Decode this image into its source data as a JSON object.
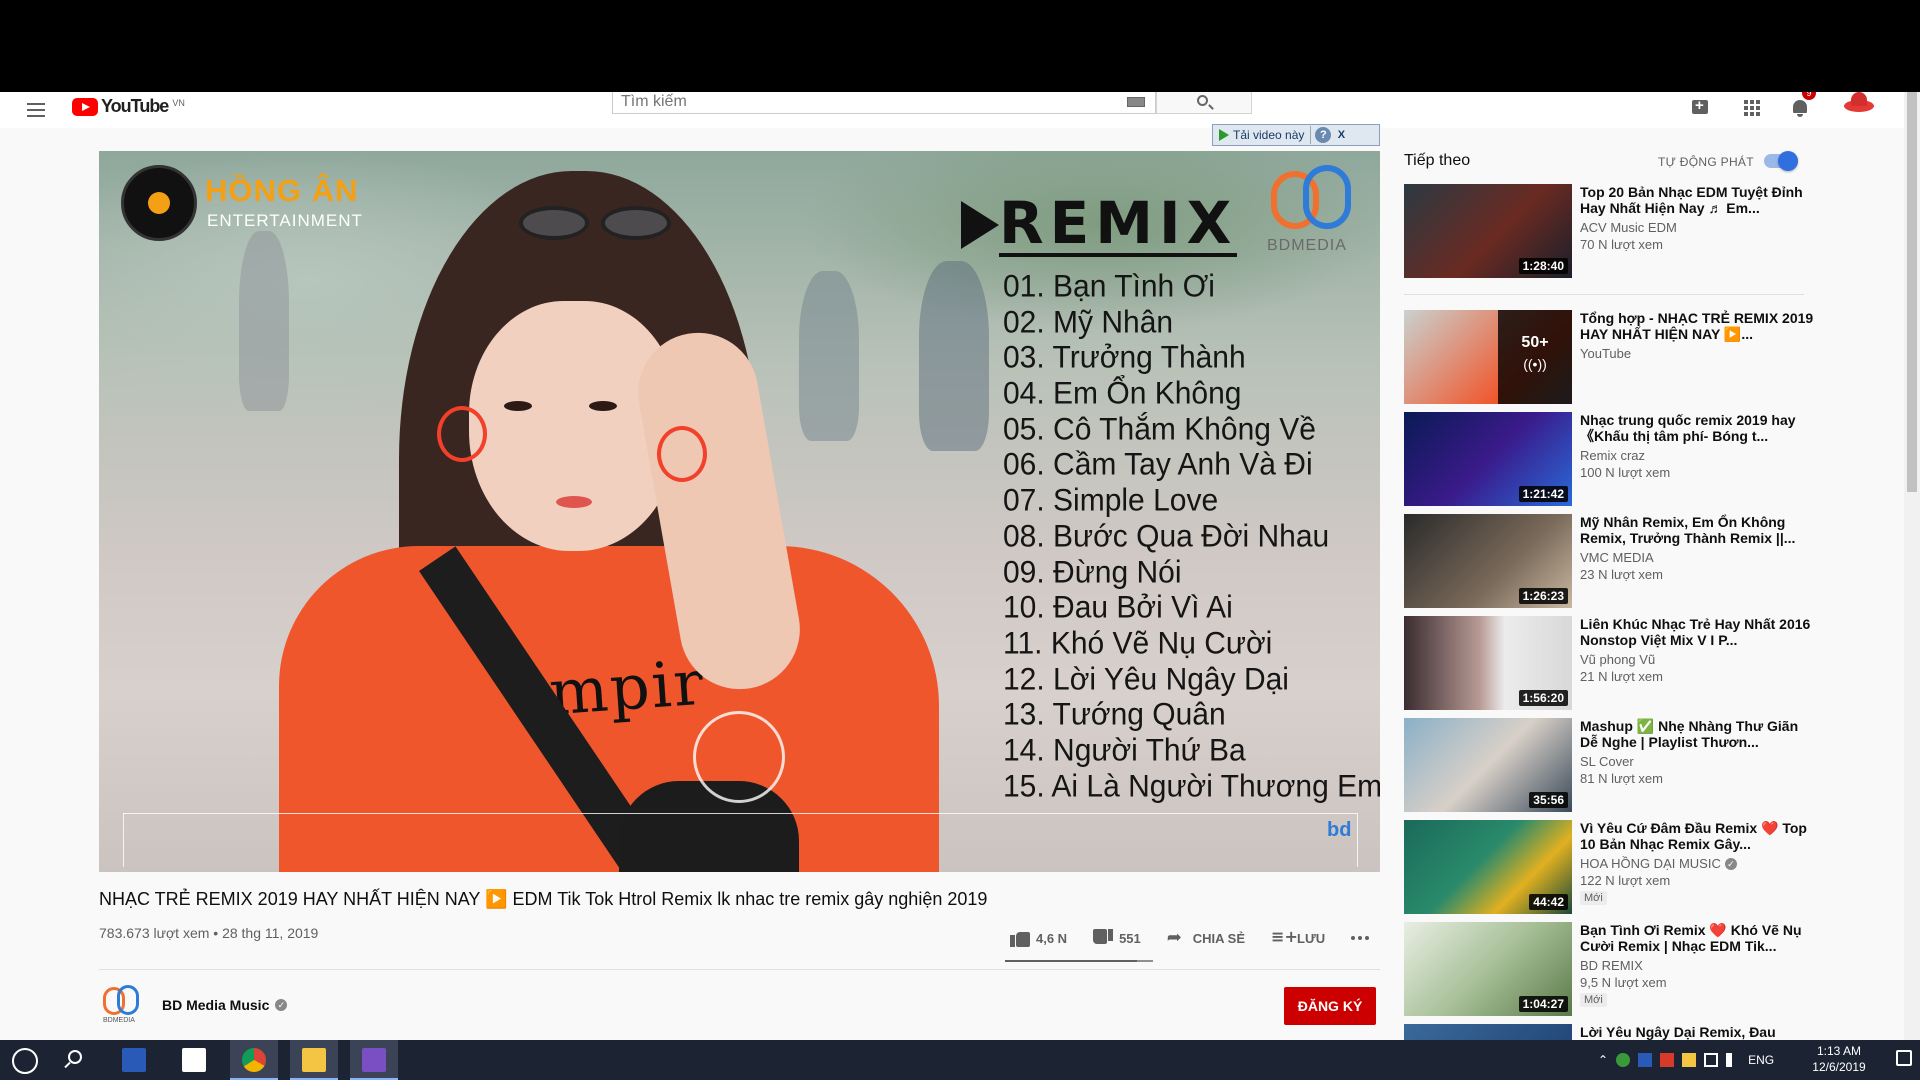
{
  "masthead": {
    "logo_text": "YouTube",
    "logo_cc": "VN",
    "search_placeholder": "Tìm kiếm",
    "notification_count": "9"
  },
  "downloader": {
    "label": "Tải video này",
    "help": "?",
    "close": "X"
  },
  "player": {
    "brand_name": "HỒNG ÂN",
    "brand_sub": "ENTERTAINMENT",
    "remix_label": "REMIX",
    "bd_label": "BDMEDIA",
    "shirt_text": "mpir",
    "bd_small": "bd",
    "tracks": [
      "01. Bạn Tình Ơi",
      "02. Mỹ Nhân",
      "03. Trưởng Thành",
      "04. Em Ổn Không",
      "05. Cô Thắm Không Về",
      "06. Cầm Tay Anh Và Đi",
      "07. Simple Love",
      "08. Bước Qua Đời Nhau",
      "09. Đừng Nói",
      "10. Đau Bởi Vì Ai",
      "11. Khó Vẽ Nụ Cười",
      "12. Lời Yêu Ngây Dại",
      "13. Tướng Quân",
      "14. Người Thứ Ba",
      "15. Ai Là Người Thương Em"
    ]
  },
  "video": {
    "title": "NHẠC TRẺ REMIX 2019 HAY NHẤT HIỆN NAY ▶️ EDM Tik Tok Htrol Remix lk nhac tre remix gây nghiện 2019",
    "meta": "783.673 lượt xem • 28 thg 11, 2019",
    "likes": "4,6 N",
    "dislikes": "551",
    "share_label": "CHIA SẺ",
    "save_label": "LƯU",
    "like_ratio": 0.89
  },
  "owner": {
    "name": "BD Media Music",
    "avatar_text": "BDMEDIA",
    "subscribe_label": "ĐĂNG KÝ"
  },
  "sidebar": {
    "up_next": "Tiếp theo",
    "autoplay": "TỰ ĐỘNG PHÁT",
    "items": [
      {
        "title": "Top 20 Bản Nhạc EDM Tuyệt Đỉnh Hay Nhất Hiện Nay ♬ Em...",
        "channel": "ACV Music EDM",
        "views": "70 N lượt xem",
        "duration": "1:28:40"
      },
      {
        "title": "Tổng hợp - NHẠC TRẺ REMIX 2019 HAY NHẤT HIỆN NAY ▶️...",
        "channel": "YouTube",
        "playlist_count": "50+"
      },
      {
        "title": "Nhạc trung quốc remix 2019 hay《Khấu thị tâm phí- Bóng t...",
        "channel": "Remix craz",
        "views": "100 N lượt xem",
        "duration": "1:21:42"
      },
      {
        "title": "Mỹ Nhân Remix, Em Ổn Không Remix, Trưởng Thành Remix ||...",
        "channel": "VMC MEDIA",
        "views": "23 N lượt xem",
        "duration": "1:26:23"
      },
      {
        "title": "Liên Khúc Nhạc Trẻ Hay Nhất 2016 Nonstop Việt Mix V I P...",
        "channel": "Vũ phong Vũ",
        "views": "21 N lượt xem",
        "duration": "1:56:20"
      },
      {
        "title": "Mashup ✅ Nhẹ Nhàng Thư Giãn Dễ Nghe | Playlist Thươn...",
        "channel": "SL Cover",
        "views": "81 N lượt xem",
        "duration": "35:56"
      },
      {
        "title": "Vì Yêu Cứ Đâm Đầu Remix ❤️ Top 10 Bản Nhạc Remix Gây...",
        "channel": "HOA HỒNG DẠI MUSIC",
        "views": "122 N lượt xem",
        "duration": "44:42",
        "badge": "Mới"
      },
      {
        "title": "Bạn Tình Ơi Remix ❤️ Khó Vẽ Nụ Cười Remix | Nhạc EDM Tik...",
        "channel": "BD REMIX",
        "views": "9,5 N lượt xem",
        "duration": "1:04:27",
        "badge": "Mới"
      },
      {
        "title": "Lời Yêu Ngây Dại Remix, Đau"
      }
    ]
  },
  "taskbar": {
    "lang": "ENG",
    "time": "1:13 AM",
    "date": "12/6/2019"
  },
  "colors": {
    "accent_red": "#cc0000",
    "toggle_blue": "#2f6fe0",
    "shirt": "#f0562c"
  }
}
